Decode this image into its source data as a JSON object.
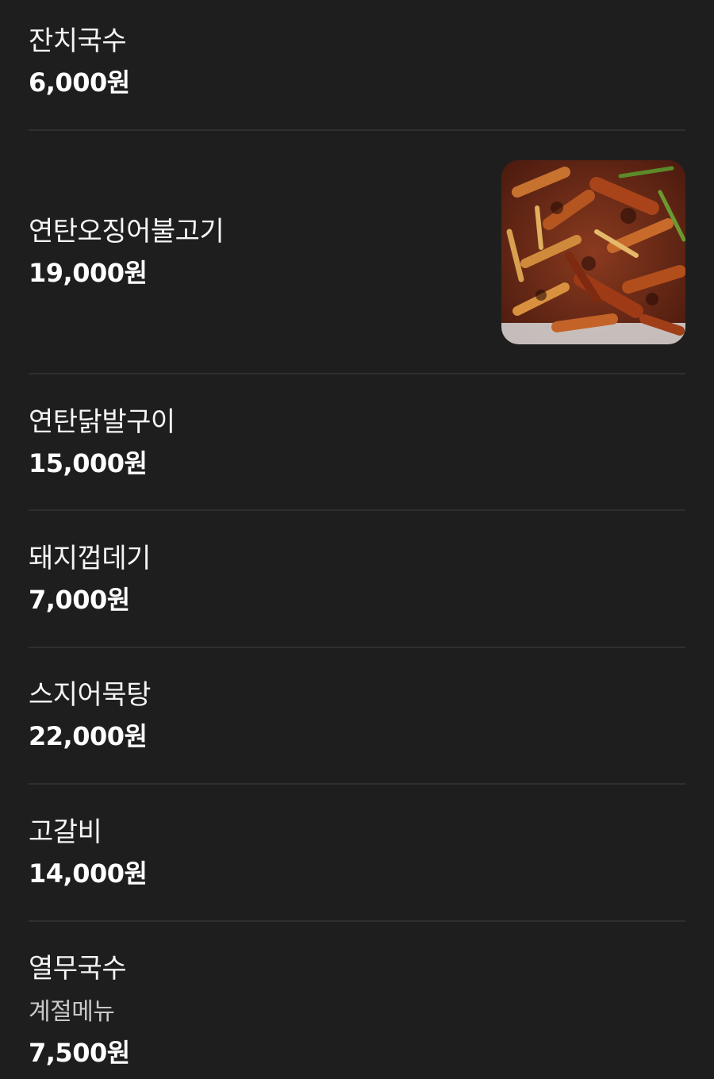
{
  "menu": {
    "items": [
      {
        "name": "잔치국수",
        "price": "6,000원"
      },
      {
        "name": "연탄오징어불고기",
        "price": "19,000원",
        "image": "spicy-squid-bulgogi-photo"
      },
      {
        "name": "연탄닭발구이",
        "price": "15,000원"
      },
      {
        "name": "돼지껍데기",
        "price": "7,000원"
      },
      {
        "name": "스지어묵탕",
        "price": "22,000원"
      },
      {
        "name": "고갈비",
        "price": "14,000원"
      },
      {
        "name": "열무국수",
        "description": "계절메뉴",
        "price": "7,500원"
      }
    ]
  },
  "colors": {
    "background": "#1e1e1e",
    "divider": "#2f2f2f",
    "text_primary": "#ffffff",
    "text_secondary": "#c9c9c9"
  }
}
